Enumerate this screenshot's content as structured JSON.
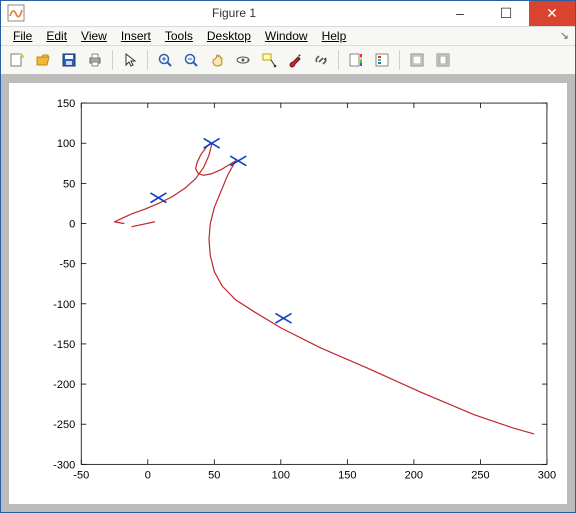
{
  "window": {
    "title": "Figure 1",
    "buttons": {
      "min": "–",
      "max": "☐",
      "close": "✕"
    }
  },
  "menu": {
    "items": [
      "File",
      "Edit",
      "View",
      "Insert",
      "Tools",
      "Desktop",
      "Window",
      "Help"
    ],
    "corner": "↘"
  },
  "toolbar": {
    "groups": [
      [
        "new-figure",
        "open",
        "save",
        "print"
      ],
      [
        "pointer"
      ],
      [
        "zoom-in",
        "zoom-out",
        "pan",
        "rotate-3d",
        "data-cursor",
        "brush",
        "link"
      ],
      [
        "insert-colorbar",
        "insert-legend"
      ],
      [
        "hide-plot-tools",
        "show-plot-tools"
      ]
    ],
    "labels": {
      "new-figure": "New Figure",
      "open": "Open",
      "save": "Save",
      "print": "Print",
      "pointer": "Edit Plot",
      "zoom-in": "Zoom In",
      "zoom-out": "Zoom Out",
      "pan": "Pan",
      "rotate-3d": "Rotate 3D",
      "data-cursor": "Data Cursor",
      "brush": "Brush",
      "link": "Link Plot",
      "insert-colorbar": "Insert Colorbar",
      "insert-legend": "Insert Legend",
      "hide-plot-tools": "Hide Plot Tools",
      "show-plot-tools": "Show Plot Tools"
    }
  },
  "chart_data": {
    "type": "line",
    "title": "",
    "xlabel": "",
    "ylabel": "",
    "xlim": [
      -50,
      300
    ],
    "ylim": [
      -300,
      150
    ],
    "xticks": [
      -50,
      0,
      50,
      100,
      150,
      200,
      250,
      300
    ],
    "yticks": [
      -300,
      -250,
      -200,
      -150,
      -100,
      -50,
      0,
      50,
      100,
      150
    ],
    "series": [
      {
        "name": "curve",
        "color": "#c1272d",
        "style": "line",
        "x": [
          -18,
          -25,
          -20,
          -12,
          -2,
          8,
          18,
          28,
          36,
          42,
          46,
          48,
          47,
          44,
          40,
          37,
          36,
          38,
          42,
          48,
          55,
          61,
          66,
          60,
          55,
          50,
          47,
          46,
          47,
          50,
          56,
          66,
          80,
          100,
          130,
          165,
          205,
          245,
          275,
          290
        ],
        "y": [
          0,
          2,
          6,
          12,
          18,
          25,
          33,
          44,
          56,
          70,
          85,
          98,
          100,
          95,
          86,
          76,
          68,
          62,
          60,
          62,
          67,
          73,
          78,
          60,
          40,
          20,
          0,
          -20,
          -40,
          -60,
          -78,
          -95,
          -110,
          -130,
          -155,
          -180,
          -210,
          -238,
          -255,
          -262
        ]
      },
      {
        "name": "tick1",
        "color": "#c1272d",
        "style": "line",
        "x": [
          -12,
          5
        ],
        "y": [
          -4,
          2
        ]
      },
      {
        "name": "markers",
        "color": "#1440c8",
        "style": "x-marker",
        "x": [
          8,
          48,
          68,
          102
        ],
        "y": [
          32,
          100,
          78,
          -118
        ]
      }
    ]
  }
}
